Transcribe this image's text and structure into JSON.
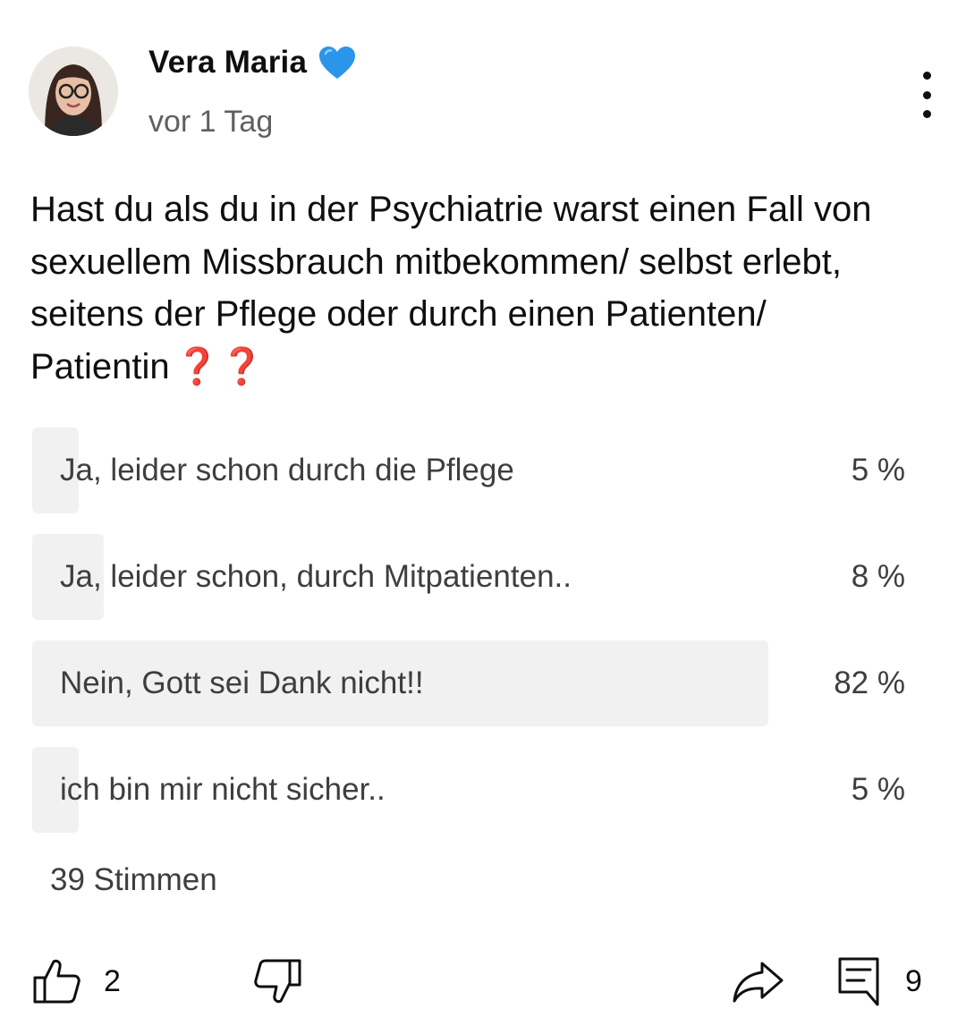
{
  "post": {
    "author": "Vera Maria",
    "time": "vor 1 Tag",
    "question": "Hast du als du in der Psychiatrie warst einen Fall von sexuellem Missbrauch mitbekommen/ selbst erlebt, seitens der Pflege oder durch einen Patienten/ Patientin",
    "question_emoji": "❓❓"
  },
  "poll": {
    "options": [
      {
        "label": "Ja, leider schon durch die Pflege",
        "percent_text": "5 %",
        "percent": 5
      },
      {
        "label": "Ja, leider schon, durch Mitpatienten..",
        "percent_text": "8 %",
        "percent": 8
      },
      {
        "label": "Nein, Gott sei Dank nicht!!",
        "percent_text": "82 %",
        "percent": 82
      },
      {
        "label": "ich bin mir nicht sicher..",
        "percent_text": "5 %",
        "percent": 5
      }
    ],
    "votes": "39 Stimmen"
  },
  "actions": {
    "likes": "2",
    "comments": "9"
  },
  "icons": {
    "author_badge": "blue-heart-icon",
    "menu": "more-vertical-icon",
    "like": "thumbs-up-icon",
    "dislike": "thumbs-down-icon",
    "share": "share-icon",
    "comment": "comment-icon"
  },
  "colors": {
    "poll_fill": "#f1f1f1",
    "heart": "#2b95ea",
    "question_emoji": "#e53935"
  }
}
